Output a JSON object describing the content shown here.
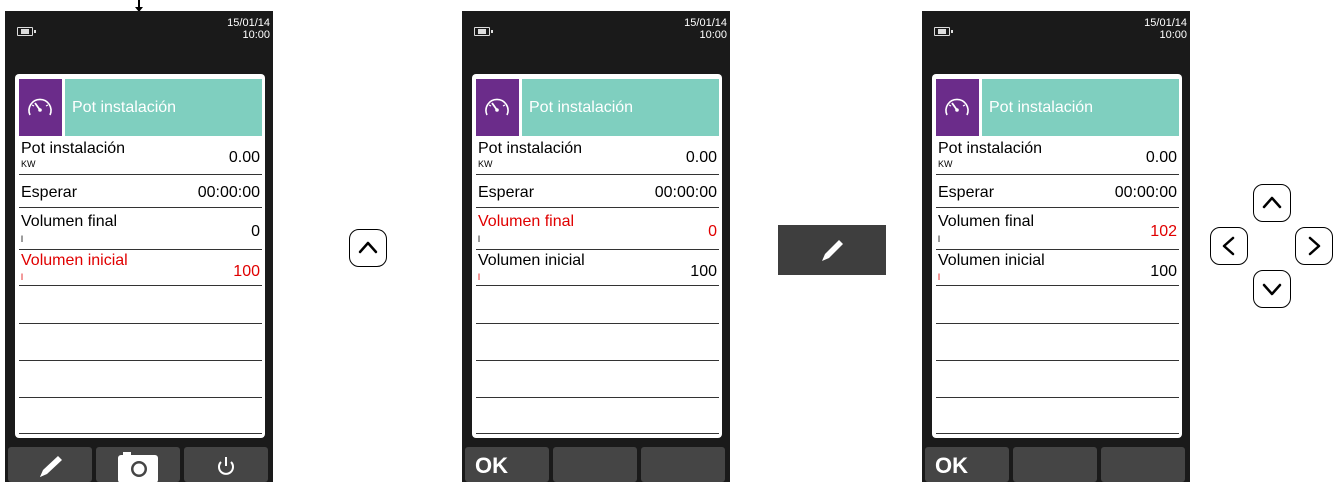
{
  "datetime": {
    "date": "15/01/14",
    "time": "10:00"
  },
  "header": {
    "title": "Pot instalación",
    "icon": "gauge-icon"
  },
  "screens": [
    {
      "rows": [
        {
          "label": "Pot instalación",
          "unit": "KW",
          "value": "0.00"
        },
        {
          "label": "Esperar",
          "unit": "",
          "value": "00:00:00"
        },
        {
          "label": "Volumen final",
          "unit": "l",
          "value": "0"
        },
        {
          "label": "Volumen inicial",
          "unit": "l",
          "value": "100"
        }
      ],
      "highlighted_row": "Volumen inicial",
      "buttons": [
        "pencil-icon",
        "camera-icon",
        "power-icon"
      ]
    },
    {
      "rows": [
        {
          "label": "Pot instalación",
          "unit": "KW",
          "value": "0.00"
        },
        {
          "label": "Esperar",
          "unit": "",
          "value": "00:00:00"
        },
        {
          "label": "Volumen final",
          "unit": "l",
          "value": "0"
        },
        {
          "label": "Volumen inicial",
          "unit": "l",
          "value": "100"
        }
      ],
      "highlighted_row": "Volumen final",
      "buttons": [
        "OK",
        "",
        ""
      ]
    },
    {
      "rows": [
        {
          "label": "Pot instalación",
          "unit": "KW",
          "value": "0.00"
        },
        {
          "label": "Esperar",
          "unit": "",
          "value": "00:00:00"
        },
        {
          "label": "Volumen final",
          "unit": "l",
          "value": "102"
        },
        {
          "label": "Volumen inicial",
          "unit": "l",
          "value": "100"
        }
      ],
      "highlighted_value": "Volumen final",
      "buttons": [
        "OK",
        "",
        ""
      ]
    }
  ],
  "keys": [
    "up-arrow-key",
    "edit-key",
    "left-arrow-key",
    "right-arrow-key",
    "down-arrow-key"
  ],
  "colors": {
    "highlight": "#e00000",
    "header_bg": "#7fcfbf",
    "icon_bg": "#6b2c8a",
    "device_bg": "#1a1a1a"
  }
}
